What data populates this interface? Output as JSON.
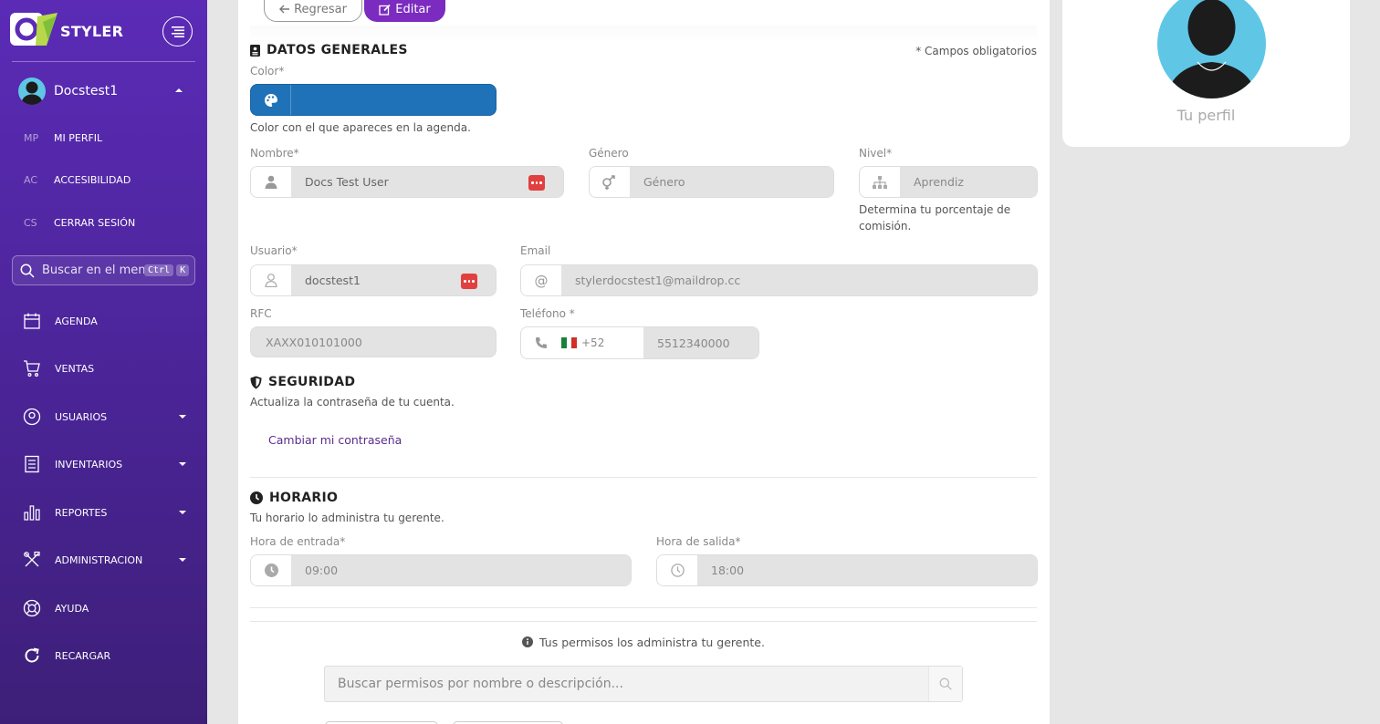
{
  "app": {
    "brand": "STYLER"
  },
  "sidebar": {
    "user_name": "Docstest1",
    "sub_items": [
      {
        "abbr": "MP",
        "label": "MI PERFIL"
      },
      {
        "abbr": "AC",
        "label": "ACCESIBILIDAD"
      },
      {
        "abbr": "CS",
        "label": "CERRAR SESIÓN"
      }
    ],
    "search_placeholder": "Buscar en el menú...",
    "search_kbd": [
      "Ctrl",
      "K"
    ],
    "nav": [
      {
        "label": "AGENDA",
        "icon": "calendar-icon",
        "has_children": false
      },
      {
        "label": "VENTAS",
        "icon": "cart-icon",
        "has_children": false
      },
      {
        "label": "USUARIOS",
        "icon": "user-circle-icon",
        "has_children": true
      },
      {
        "label": "INVENTARIOS",
        "icon": "clipboard-icon",
        "has_children": true
      },
      {
        "label": "REPORTES",
        "icon": "bar-chart-icon",
        "has_children": true
      },
      {
        "label": "ADMINISTRACION",
        "icon": "tools-icon",
        "has_children": true
      },
      {
        "label": "AYUDA",
        "icon": "lifebuoy-icon",
        "has_children": false
      },
      {
        "label": "RECARGAR",
        "icon": "refresh-icon",
        "has_children": false
      }
    ]
  },
  "toolbar": {
    "back_label": "Regresar",
    "edit_label": "Editar"
  },
  "general": {
    "title": "DATOS GENERALES",
    "required_note": "* Campos obligatorios",
    "color_label": "Color*",
    "color_value": "#1f72b8",
    "color_help": "Color con el que apareces en la agenda.",
    "name_label": "Nombre*",
    "name_value": "Docs Test User",
    "gender_label": "Género",
    "gender_value": "Género",
    "level_label": "Nivel*",
    "level_value": "Aprendiz",
    "level_help": "Determina tu porcentaje de comisión.",
    "user_label": "Usuario*",
    "user_value": "docstest1",
    "email_label": "Email",
    "email_value": "stylerdocstest1@maildrop.cc",
    "rfc_label": "RFC",
    "rfc_value": "XAXX010101000",
    "phone_label": "Teléfono *",
    "phone_code": "+52",
    "phone_value": "5512340000"
  },
  "security": {
    "title": "SEGURIDAD",
    "subtitle": "Actualiza la contraseña de tu cuenta.",
    "change_link": "Cambiar mi contraseña"
  },
  "schedule": {
    "title": "HORARIO",
    "subtitle": "Tu horario lo administra tu gerente.",
    "in_label": "Hora de entrada*",
    "in_value": "09:00",
    "out_label": "Hora de salida*",
    "out_value": "18:00"
  },
  "permissions": {
    "note": "Tus permisos los administra tu gerente.",
    "search_placeholder": "Buscar permisos por nombre o descripción..."
  },
  "profile": {
    "label": "Tu perfil"
  },
  "colors": {
    "sidebar": "#5b2bb6",
    "accent": "#7b2bbf",
    "link": "#5a2d8c",
    "badge": "#e04040"
  }
}
